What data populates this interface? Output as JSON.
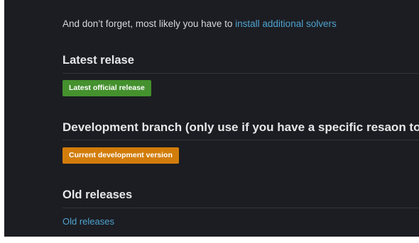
{
  "intro": {
    "text": "And don’t forget, most likely you have to ",
    "link_text": "install additional solvers"
  },
  "sections": {
    "latest": {
      "heading": "Latest relase",
      "button_label": "Latest official release"
    },
    "development": {
      "heading": "Development branch (only use if you have a specific resaon to...)",
      "button_label": "Current development version"
    },
    "old": {
      "heading": "Old releases",
      "link_text": "Old releases"
    }
  },
  "colors": {
    "background": "#1c1d22",
    "link": "#4fa3d1",
    "green_button": "#44912e",
    "orange_button": "#d27d0b"
  }
}
